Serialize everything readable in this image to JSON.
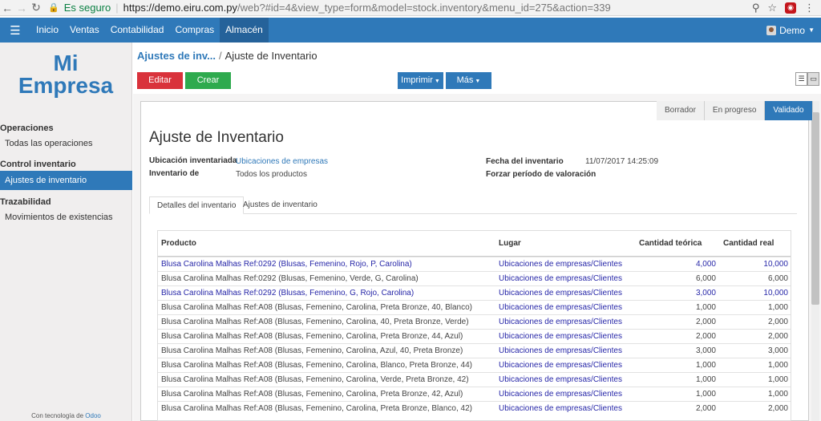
{
  "browser": {
    "secure_label": "Es seguro",
    "url_host": "https://demo.eiru.com.py",
    "url_path": "/web?#id=4&view_type=form&model=stock.inventory&menu_id=275&action=339"
  },
  "topnav": {
    "items": [
      "Inicio",
      "Ventas",
      "Contabilidad",
      "Compras",
      "Almacén"
    ],
    "active": "Almacén",
    "user": "Demo"
  },
  "sidebar": {
    "logo_line1": "Mi",
    "logo_line2": "Empresa",
    "sections": [
      {
        "title": "Operaciones",
        "items": [
          "Todas las operaciones"
        ]
      },
      {
        "title": "Control inventario",
        "items": [
          "Ajustes de inventario"
        ]
      },
      {
        "title": "Trazabilidad",
        "items": [
          "Movimientos de existencias"
        ]
      }
    ],
    "active_item": "Ajustes de inventario",
    "powered_by": "Con tecnología de",
    "powered_brand": "Odoo"
  },
  "breadcrumb": {
    "parent": "Ajustes de inv...",
    "current": "Ajuste de Inventario"
  },
  "buttons": {
    "edit": "Editar",
    "create": "Crear",
    "print": "Imprimir",
    "more": "Más"
  },
  "statusbar": {
    "stages": [
      "Borrador",
      "En progreso",
      "Validado"
    ],
    "current": "Validado"
  },
  "form": {
    "title": "Ajuste de Inventario",
    "location_label": "Ubicación inventariada",
    "location_value": "Ubicaciones de empresas",
    "inventory_of_label": "Inventario de",
    "inventory_of_value": "Todos los productos",
    "date_label": "Fecha del inventario",
    "date_value": "11/07/2017 14:25:09",
    "force_label": "Forzar período de valoración"
  },
  "tabs": [
    "Detalles del inventario",
    "Ajustes de inventario"
  ],
  "table": {
    "headers": [
      "Producto",
      "Lugar",
      "Cantidad teórica",
      "Cantidad real"
    ],
    "rows": [
      {
        "product": "Blusa Carolina Malhas Ref:0292 (Blusas, Femenino, Rojo, P, Carolina)",
        "location": "Ubicaciones de empresas/Clientes",
        "theoretical": "4,000",
        "real": "10,000",
        "highlight": true
      },
      {
        "product": "Blusa Carolina Malhas Ref:0292 (Blusas, Femenino, Verde, G, Carolina)",
        "location": "Ubicaciones de empresas/Clientes",
        "theoretical": "6,000",
        "real": "6,000",
        "highlight": false
      },
      {
        "product": "Blusa Carolina Malhas Ref:0292 (Blusas, Femenino, G, Rojo, Carolina)",
        "location": "Ubicaciones de empresas/Clientes",
        "theoretical": "3,000",
        "real": "10,000",
        "highlight": true
      },
      {
        "product": "Blusa Carolina Malhas Ref:A08 (Blusas, Femenino, Carolina, Preta Bronze, 40, Blanco)",
        "location": "Ubicaciones de empresas/Clientes",
        "theoretical": "1,000",
        "real": "1,000",
        "highlight": false
      },
      {
        "product": "Blusa Carolina Malhas Ref:A08 (Blusas, Femenino, Carolina, 40, Preta Bronze, Verde)",
        "location": "Ubicaciones de empresas/Clientes",
        "theoretical": "2,000",
        "real": "2,000",
        "highlight": false
      },
      {
        "product": "Blusa Carolina Malhas Ref:A08 (Blusas, Femenino, Carolina, Preta Bronze, 44, Azul)",
        "location": "Ubicaciones de empresas/Clientes",
        "theoretical": "2,000",
        "real": "2,000",
        "highlight": false
      },
      {
        "product": "Blusa Carolina Malhas Ref:A08 (Blusas, Femenino, Carolina, Azul, 40, Preta Bronze)",
        "location": "Ubicaciones de empresas/Clientes",
        "theoretical": "3,000",
        "real": "3,000",
        "highlight": false
      },
      {
        "product": "Blusa Carolina Malhas Ref:A08 (Blusas, Femenino, Carolina, Blanco, Preta Bronze, 44)",
        "location": "Ubicaciones de empresas/Clientes",
        "theoretical": "1,000",
        "real": "1,000",
        "highlight": false
      },
      {
        "product": "Blusa Carolina Malhas Ref:A08 (Blusas, Femenino, Carolina, Verde, Preta Bronze, 42)",
        "location": "Ubicaciones de empresas/Clientes",
        "theoretical": "1,000",
        "real": "1,000",
        "highlight": false
      },
      {
        "product": "Blusa Carolina Malhas Ref:A08 (Blusas, Femenino, Carolina, Preta Bronze, 42, Azul)",
        "location": "Ubicaciones de empresas/Clientes",
        "theoretical": "1,000",
        "real": "1,000",
        "highlight": false
      },
      {
        "product": "Blusa Carolina Malhas Ref:A08 (Blusas, Femenino, Carolina, Preta Bronze, Blanco, 42)",
        "location": "Ubicaciones de empresas/Clientes",
        "theoretical": "2,000",
        "real": "2,000",
        "highlight": false
      }
    ]
  },
  "colors": {
    "brand": "#2f79b9",
    "edit": "#d9323b",
    "create": "#2eaa4e"
  }
}
